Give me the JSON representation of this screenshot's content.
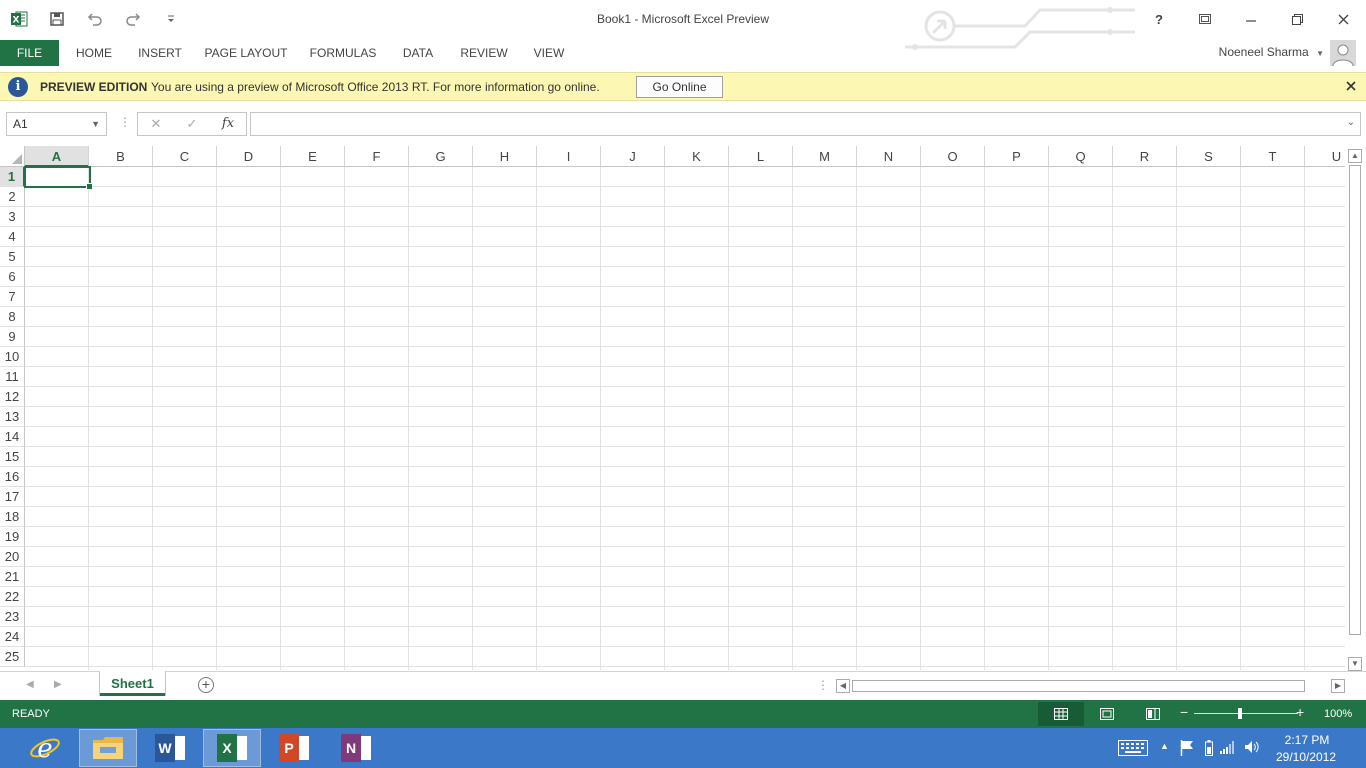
{
  "window": {
    "title": "Book1 - Microsoft Excel Preview",
    "brand_color": "#217346"
  },
  "ribbon": {
    "tabs": [
      {
        "label": "FILE"
      },
      {
        "label": "HOME"
      },
      {
        "label": "INSERT"
      },
      {
        "label": "PAGE LAYOUT"
      },
      {
        "label": "FORMULAS"
      },
      {
        "label": "DATA"
      },
      {
        "label": "REVIEW"
      },
      {
        "label": "VIEW"
      }
    ],
    "user_name": "Noeneel Sharma"
  },
  "message_bar": {
    "title": "PREVIEW EDITION",
    "text": "You are using a preview of Microsoft Office 2013 RT. For more information go online.",
    "button_label": "Go Online"
  },
  "formula_bar": {
    "name_box": "A1",
    "fx_label": "fx",
    "formula_value": ""
  },
  "grid": {
    "columns": [
      "A",
      "B",
      "C",
      "D",
      "E",
      "F",
      "G",
      "H",
      "I",
      "J",
      "K",
      "L",
      "M",
      "N",
      "O",
      "P",
      "Q",
      "R",
      "S",
      "T",
      "U"
    ],
    "rows": [
      "1",
      "2",
      "3",
      "4",
      "5",
      "6",
      "7",
      "8",
      "9",
      "10",
      "11",
      "12",
      "13",
      "14",
      "15",
      "16",
      "17",
      "18",
      "19",
      "20",
      "21",
      "22",
      "23",
      "24",
      "25"
    ],
    "selected_column": "A",
    "selected_row": "1"
  },
  "sheets": {
    "tabs": [
      {
        "label": "Sheet1",
        "active": true
      }
    ]
  },
  "status_bar": {
    "status": "READY",
    "zoom": "100%"
  },
  "taskbar": {
    "apps": [
      {
        "name": "internet-explorer",
        "letter": "e"
      },
      {
        "name": "file-explorer",
        "letter": ""
      },
      {
        "name": "word",
        "letter": "W",
        "color": "#2b579a"
      },
      {
        "name": "excel",
        "letter": "X",
        "color": "#217346",
        "active": true
      },
      {
        "name": "powerpoint",
        "letter": "P",
        "color": "#d24726"
      },
      {
        "name": "onenote",
        "letter": "N",
        "color": "#80397b"
      }
    ],
    "time": "2:17 PM",
    "date": "29/10/2012"
  }
}
